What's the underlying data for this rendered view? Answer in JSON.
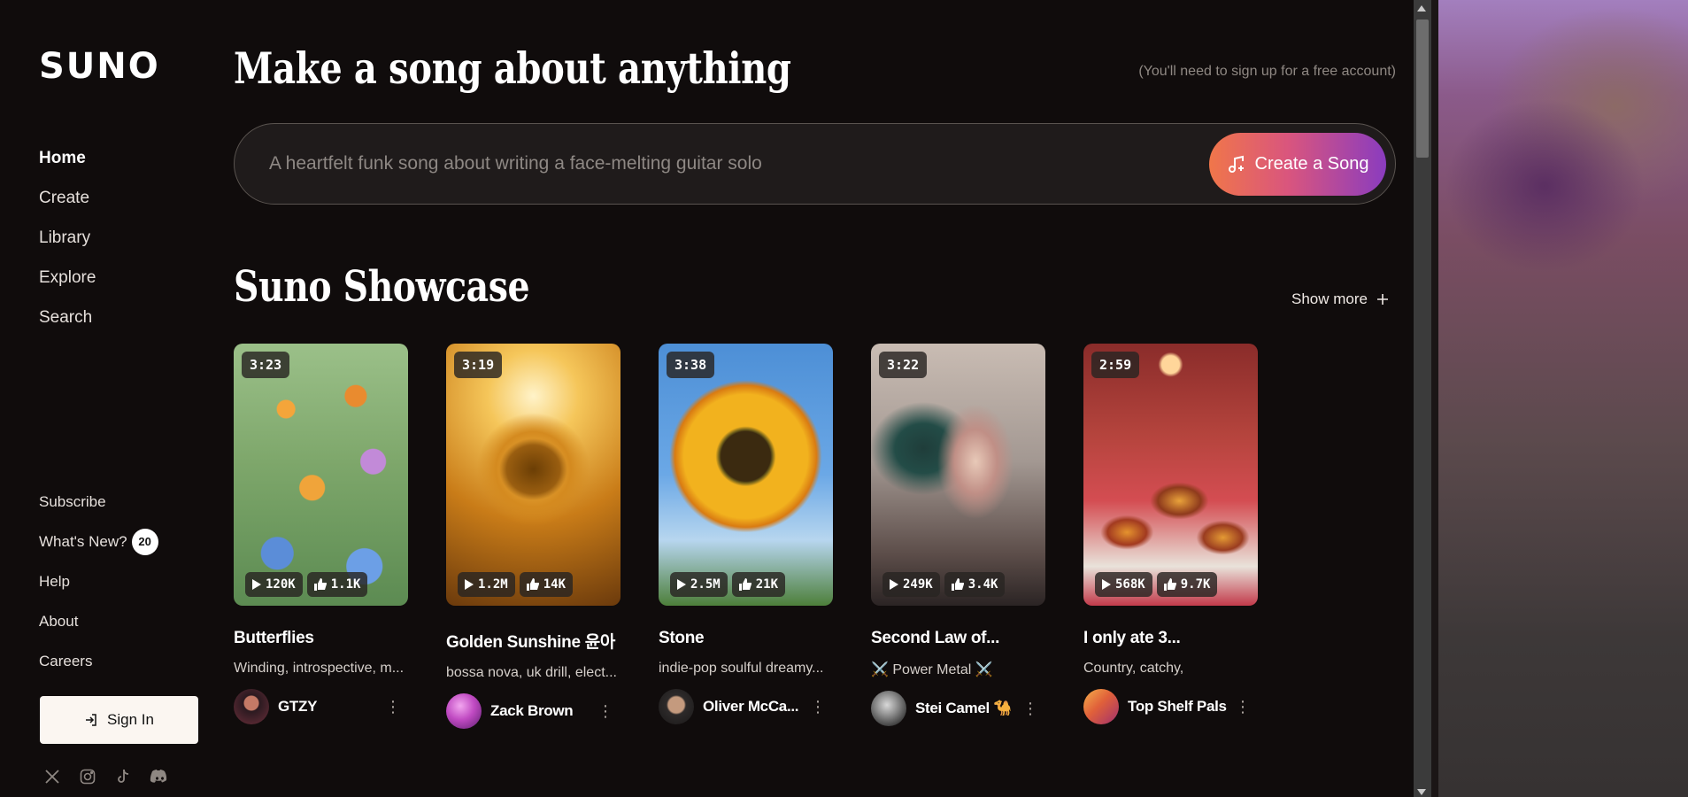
{
  "brand": {
    "logo": "SUNO"
  },
  "nav": [
    {
      "label": "Home",
      "active": true
    },
    {
      "label": "Create"
    },
    {
      "label": "Library"
    },
    {
      "label": "Explore"
    },
    {
      "label": "Search"
    }
  ],
  "subnav": {
    "subscribe": "Subscribe",
    "whats_new": "What's New?",
    "whats_new_count": "20",
    "help": "Help",
    "about": "About",
    "careers": "Careers"
  },
  "signin_label": "Sign In",
  "socials": [
    "x-icon",
    "instagram-icon",
    "tiktok-icon",
    "discord-icon"
  ],
  "hero": {
    "headline": "Make a song about anything",
    "signup_note": "(You'll need to sign up for a free account)",
    "prompt_placeholder": "A heartfelt funk song about writing a face-melting guitar solo",
    "create_label": "Create a Song"
  },
  "showcase": {
    "title": "Suno Showcase",
    "show_more": "Show more",
    "cards": [
      {
        "duration": "3:23",
        "plays": "120K",
        "likes": "1.1K",
        "title": "Butterflies",
        "desc": "Winding, introspective, m...",
        "author": "GTZY"
      },
      {
        "duration": "3:19",
        "plays": "1.2M",
        "likes": "14K",
        "title": "Golden Sunshine 윤아",
        "desc": "bossa nova, uk drill, elect...",
        "author": "Zack Brown"
      },
      {
        "duration": "3:38",
        "plays": "2.5M",
        "likes": "21K",
        "title": "Stone",
        "desc": "indie-pop soulful dreamy...",
        "author": "Oliver McCa..."
      },
      {
        "duration": "3:22",
        "plays": "249K",
        "likes": "3.4K",
        "title": "Second Law of...",
        "desc": "⚔️ Power Metal ⚔️",
        "author": "Stei Camel 🐪"
      },
      {
        "duration": "2:59",
        "plays": "568K",
        "likes": "9.7K",
        "title": "I only ate 3...",
        "desc": "Country, catchy,",
        "author": "Top Shelf Pals"
      }
    ]
  },
  "colors": {
    "background": "#100c0c",
    "create_gradient_start": "#f0764a",
    "create_gradient_end": "#8a3cbf"
  }
}
